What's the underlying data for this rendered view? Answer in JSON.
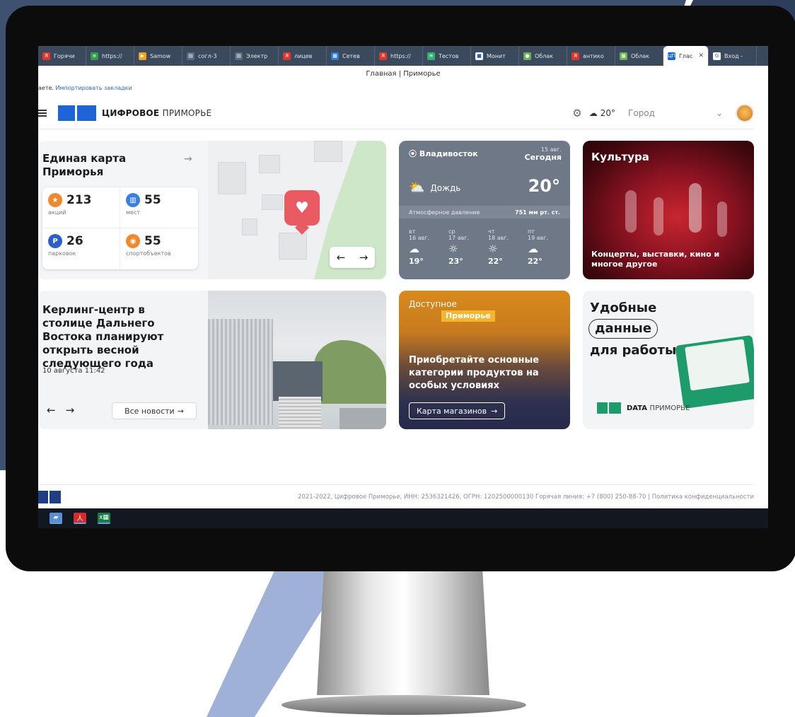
{
  "browser": {
    "tabs": [
      {
        "label": "Горячи",
        "fav": "Я",
        "color": "#e0352b"
      },
      {
        "label": "https://",
        "fav": "≡",
        "color": "#2e9e4f"
      },
      {
        "label": "Samow",
        "fav": "▶",
        "color": "#f2a31c"
      },
      {
        "label": "согл-3",
        "fav": "▤",
        "color": "#5a6b7d"
      },
      {
        "label": "Электр",
        "fav": "▤",
        "color": "#5a6b7d"
      },
      {
        "label": "лицев",
        "fav": "Я",
        "color": "#e0352b"
      },
      {
        "label": "Сетев",
        "fav": "▦",
        "color": "#2e7bd6"
      },
      {
        "label": "https://",
        "fav": "Я",
        "color": "#e0352b"
      },
      {
        "label": "Тестов",
        "fav": "≋",
        "color": "#2fb36d"
      },
      {
        "label": "Монит",
        "fav": "■",
        "color": "#ffffff"
      },
      {
        "label": "Облак",
        "fav": "●",
        "color": "#6bb04f"
      },
      {
        "label": "антико",
        "fav": "Я",
        "color": "#e0352b"
      },
      {
        "label": "Облак",
        "fav": "▦",
        "color": "#6bb04f"
      },
      {
        "label": "Глас",
        "fav": "ЦП",
        "color": "#1f63d9",
        "active": true
      },
      {
        "label": "Вход -",
        "fav": "G",
        "color": "#ffffff"
      }
    ],
    "active_tab_close": "✕",
    "page_title": "Главная | Приморье",
    "bookmarks_prefix": "аете.",
    "bookmarks_link": "Импортировать закладки"
  },
  "header": {
    "logo_bold": "ЦИФРОВОЕ",
    "logo_thin": "ПРИМОРЬЕ",
    "settings_icon": "⚙",
    "weather_icon": "☁",
    "temperature": "20°",
    "city_placeholder": "Город",
    "chevron": "⌄"
  },
  "map_card": {
    "title": "Единая карта Приморья",
    "arrow": "→",
    "stats": [
      {
        "value": "213",
        "label": "акций",
        "icon": "★",
        "color": "#f0892e"
      },
      {
        "value": "55",
        "label": "мест",
        "icon": "▥",
        "color": "#3b7fe3"
      },
      {
        "value": "26",
        "label": "парковок",
        "icon": "P",
        "color": "#2b5fc9"
      },
      {
        "value": "55",
        "label": "спортобъектов",
        "icon": "◉",
        "color": "#f0892e"
      }
    ],
    "nav_prev": "←",
    "nav_next": "→"
  },
  "weather_card": {
    "city": "Владивосток",
    "date": "15 авг.",
    "today": "Сегодня",
    "condition": "Дождь",
    "temp": "20°",
    "pressure_label": "Атмосферное давление",
    "pressure_value": "751 мм рт. ст.",
    "forecast": [
      {
        "day": "вт",
        "date": "16 авг.",
        "icon": "☁",
        "temp": "19°"
      },
      {
        "day": "ср",
        "date": "17 авг.",
        "icon": "☼",
        "temp": "23°"
      },
      {
        "day": "чт",
        "date": "18 авг.",
        "icon": "☼",
        "temp": "22°"
      },
      {
        "day": "пт",
        "date": "19 авг.",
        "icon": "☁",
        "temp": "22°"
      }
    ]
  },
  "culture_card": {
    "title": "Культура",
    "subtitle": "Концерты, выставки, кино и многое другое"
  },
  "news_card": {
    "title": "Керлинг-центр в столице Дальнего Востока планируют открыть весной следующего года",
    "date": "10 августа 11:42",
    "prev": "←",
    "next": "→",
    "all_news": "Все новости",
    "all_news_arrow": "→"
  },
  "promo_card": {
    "top": "Доступное",
    "tag": "Приморье",
    "main": "Приобретайте основные категории продуктов на особых условиях",
    "button": "Карта магазинов",
    "button_arrow": "→"
  },
  "data_card": {
    "line1": "Удобные",
    "line2": "данные",
    "line3": "для работы",
    "logo_bold": "DATA",
    "logo_thin": "ПРИМОРЬЕ"
  },
  "footer": {
    "text": "2021-2022, Цифровое Приморье, ИНН: 2536321426, ОГРН: 1202500000130   Горячая линия: +7 (800) 250-88-70  |  Политика конфиденциальности"
  },
  "taskbar": {
    "icons": [
      {
        "glyph": "▰",
        "color": "#5a8fd6"
      },
      {
        "glyph": "人",
        "color": "#d42b2b"
      },
      {
        "glyph": "x▦",
        "color": "#1d7a45"
      }
    ]
  }
}
